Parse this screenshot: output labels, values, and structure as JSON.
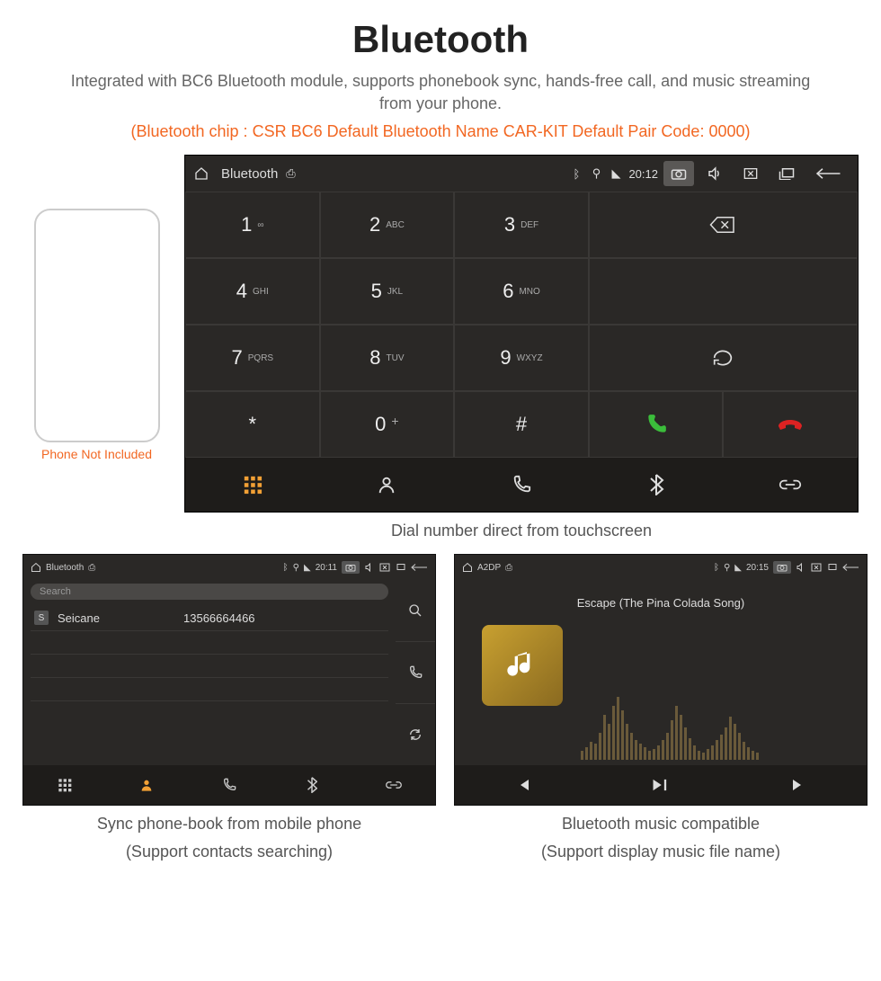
{
  "header": {
    "title": "Bluetooth",
    "desc": "Integrated with BC6 Bluetooth module, supports phonebook sync, hands-free call, and music streaming from your phone.",
    "specs": "(Bluetooth chip : CSR BC6     Default Bluetooth Name CAR-KIT     Default Pair Code: 0000)"
  },
  "phone_caption": "Phone Not Included",
  "dialer": {
    "status": {
      "title": "Bluetooth",
      "time": "20:12"
    },
    "keys": [
      {
        "num": "1",
        "sub": "∞"
      },
      {
        "num": "2",
        "sub": "ABC"
      },
      {
        "num": "3",
        "sub": "DEF"
      },
      {
        "num": "4",
        "sub": "GHI"
      },
      {
        "num": "5",
        "sub": "JKL"
      },
      {
        "num": "6",
        "sub": "MNO"
      },
      {
        "num": "7",
        "sub": "PQRS"
      },
      {
        "num": "8",
        "sub": "TUV"
      },
      {
        "num": "9",
        "sub": "WXYZ"
      },
      {
        "num": "*",
        "sub": ""
      },
      {
        "num": "0",
        "sub": "+"
      },
      {
        "num": "#",
        "sub": ""
      }
    ],
    "caption": "Dial number direct from touchscreen"
  },
  "contacts": {
    "status": {
      "title": "Bluetooth",
      "time": "20:11"
    },
    "search_placeholder": "Search",
    "rows": [
      {
        "badge": "S",
        "name": "Seicane",
        "number": "13566664466"
      }
    ],
    "caption1": "Sync phone-book from mobile phone",
    "caption2": "(Support contacts searching)"
  },
  "music": {
    "status": {
      "title": "A2DP",
      "time": "20:15"
    },
    "song": "Escape (The Pina Colada Song)",
    "caption1": "Bluetooth music compatible",
    "caption2": "(Support display music file name)"
  }
}
